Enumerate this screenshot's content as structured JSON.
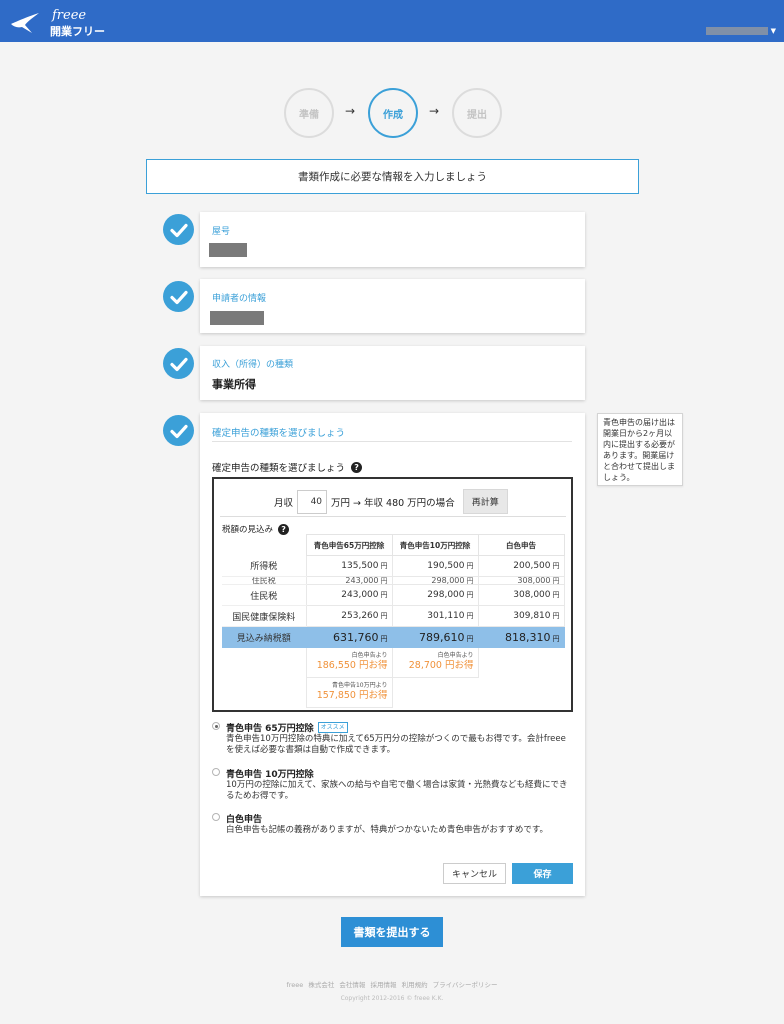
{
  "header": {
    "brand": "freee",
    "product": "開業フリー",
    "accent_color": "#2f6bc7"
  },
  "steps": [
    {
      "label": "準備",
      "active": false
    },
    {
      "label": "作成",
      "active": true
    },
    {
      "label": "提出",
      "active": false
    }
  ],
  "step_arrow": "→",
  "banner": "書類作成に必要な情報を入力しましょう",
  "sections": {
    "trade_name": {
      "label": "屋号",
      "completed": true
    },
    "applicant": {
      "label": "申請者の情報",
      "completed": true
    },
    "income_type": {
      "label": "収入（所得）の種類",
      "value": "事業所得",
      "completed": true
    },
    "return_type": {
      "label": "確定申告の種類を選びましょう",
      "completed": true
    }
  },
  "tooltip": "青色申告の届け出は開業日から2ヶ月以内に提出する必要があります。開業届けと合わせて提出しましょう。",
  "question": "確定申告の種類を選びましょう",
  "simulator": {
    "monthly_label": "月収",
    "monthly_value": "40",
    "unit_suffix": "万円 → 年収 480 万円の場合",
    "recalc": "再計算",
    "estimate_label": "税額の見込み",
    "columns": [
      "青色申告65万円控除",
      "青色申告10万円控除",
      "白色申告"
    ],
    "yen": "円",
    "rows": [
      {
        "label": "所得税",
        "values": [
          "135,500",
          "190,500",
          "200,500"
        ]
      },
      {
        "label": "住民税",
        "values": [
          "243,000",
          "298,000",
          "308,000"
        ]
      },
      {
        "label": "住民税",
        "values": [
          "243,000",
          "298,000",
          "308,000"
        ]
      },
      {
        "label": "国民健康保険料",
        "values": [
          "253,260",
          "301,110",
          "309,810"
        ]
      }
    ],
    "total": {
      "label": "見込み納税額",
      "values": [
        "631,760",
        "789,610",
        "818,310"
      ]
    },
    "savings": [
      {
        "caption": "白色申告より",
        "amount": "186,550 円お得"
      },
      {
        "caption": "白色申告より",
        "amount": "28,700 円お得"
      },
      {
        "caption": "青色申告10万円より",
        "amount": "157,850 円お得"
      }
    ]
  },
  "options": [
    {
      "title": "青色申告 65万円控除",
      "badge": "オススメ",
      "selected": true,
      "desc": "青色申告10万円控除の特典に加えて65万円分の控除がつくので最もお得です。会計freeeを使えば必要な書類は自動で作成できます。"
    },
    {
      "title": "青色申告 10万円控除",
      "badge": "",
      "selected": false,
      "desc": "10万円の控除に加えて、家族への給与や自宅で働く場合は家賃・光熱費なども経費にできるためお得です。"
    },
    {
      "title": "白色申告",
      "badge": "",
      "selected": false,
      "desc": "白色申告も記帳の義務がありますが、特典がつかないため青色申告がおすすめです。"
    }
  ],
  "buttons": {
    "cancel": "キャンセル",
    "save": "保存",
    "submit": "書類を提出する"
  },
  "footer": {
    "links": [
      "freee 株式会社",
      "会社情報",
      "採用情報",
      "利用規約",
      "プライバシーポリシー"
    ],
    "copyright": "Copyright 2012-2016 © freee K.K."
  }
}
